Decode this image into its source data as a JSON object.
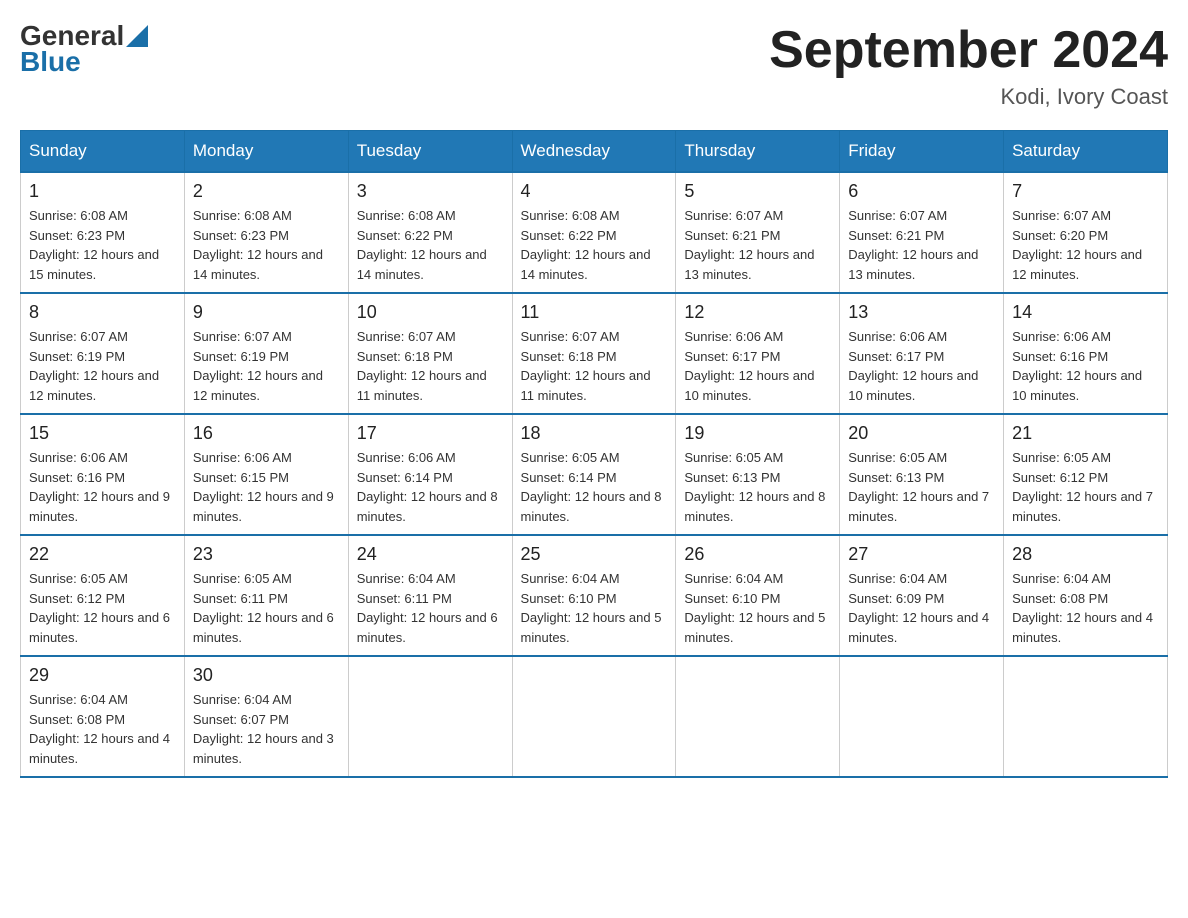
{
  "logo": {
    "general": "General",
    "blue": "Blue",
    "arrow": "▲"
  },
  "title": "September 2024",
  "subtitle": "Kodi, Ivory Coast",
  "days": [
    "Sunday",
    "Monday",
    "Tuesday",
    "Wednesday",
    "Thursday",
    "Friday",
    "Saturday"
  ],
  "weeks": [
    [
      {
        "num": "1",
        "sunrise": "6:08 AM",
        "sunset": "6:23 PM",
        "daylight": "12 hours and 15 minutes."
      },
      {
        "num": "2",
        "sunrise": "6:08 AM",
        "sunset": "6:23 PM",
        "daylight": "12 hours and 14 minutes."
      },
      {
        "num": "3",
        "sunrise": "6:08 AM",
        "sunset": "6:22 PM",
        "daylight": "12 hours and 14 minutes."
      },
      {
        "num": "4",
        "sunrise": "6:08 AM",
        "sunset": "6:22 PM",
        "daylight": "12 hours and 14 minutes."
      },
      {
        "num": "5",
        "sunrise": "6:07 AM",
        "sunset": "6:21 PM",
        "daylight": "12 hours and 13 minutes."
      },
      {
        "num": "6",
        "sunrise": "6:07 AM",
        "sunset": "6:21 PM",
        "daylight": "12 hours and 13 minutes."
      },
      {
        "num": "7",
        "sunrise": "6:07 AM",
        "sunset": "6:20 PM",
        "daylight": "12 hours and 12 minutes."
      }
    ],
    [
      {
        "num": "8",
        "sunrise": "6:07 AM",
        "sunset": "6:19 PM",
        "daylight": "12 hours and 12 minutes."
      },
      {
        "num": "9",
        "sunrise": "6:07 AM",
        "sunset": "6:19 PM",
        "daylight": "12 hours and 12 minutes."
      },
      {
        "num": "10",
        "sunrise": "6:07 AM",
        "sunset": "6:18 PM",
        "daylight": "12 hours and 11 minutes."
      },
      {
        "num": "11",
        "sunrise": "6:07 AM",
        "sunset": "6:18 PM",
        "daylight": "12 hours and 11 minutes."
      },
      {
        "num": "12",
        "sunrise": "6:06 AM",
        "sunset": "6:17 PM",
        "daylight": "12 hours and 10 minutes."
      },
      {
        "num": "13",
        "sunrise": "6:06 AM",
        "sunset": "6:17 PM",
        "daylight": "12 hours and 10 minutes."
      },
      {
        "num": "14",
        "sunrise": "6:06 AM",
        "sunset": "6:16 PM",
        "daylight": "12 hours and 10 minutes."
      }
    ],
    [
      {
        "num": "15",
        "sunrise": "6:06 AM",
        "sunset": "6:16 PM",
        "daylight": "12 hours and 9 minutes."
      },
      {
        "num": "16",
        "sunrise": "6:06 AM",
        "sunset": "6:15 PM",
        "daylight": "12 hours and 9 minutes."
      },
      {
        "num": "17",
        "sunrise": "6:06 AM",
        "sunset": "6:14 PM",
        "daylight": "12 hours and 8 minutes."
      },
      {
        "num": "18",
        "sunrise": "6:05 AM",
        "sunset": "6:14 PM",
        "daylight": "12 hours and 8 minutes."
      },
      {
        "num": "19",
        "sunrise": "6:05 AM",
        "sunset": "6:13 PM",
        "daylight": "12 hours and 8 minutes."
      },
      {
        "num": "20",
        "sunrise": "6:05 AM",
        "sunset": "6:13 PM",
        "daylight": "12 hours and 7 minutes."
      },
      {
        "num": "21",
        "sunrise": "6:05 AM",
        "sunset": "6:12 PM",
        "daylight": "12 hours and 7 minutes."
      }
    ],
    [
      {
        "num": "22",
        "sunrise": "6:05 AM",
        "sunset": "6:12 PM",
        "daylight": "12 hours and 6 minutes."
      },
      {
        "num": "23",
        "sunrise": "6:05 AM",
        "sunset": "6:11 PM",
        "daylight": "12 hours and 6 minutes."
      },
      {
        "num": "24",
        "sunrise": "6:04 AM",
        "sunset": "6:11 PM",
        "daylight": "12 hours and 6 minutes."
      },
      {
        "num": "25",
        "sunrise": "6:04 AM",
        "sunset": "6:10 PM",
        "daylight": "12 hours and 5 minutes."
      },
      {
        "num": "26",
        "sunrise": "6:04 AM",
        "sunset": "6:10 PM",
        "daylight": "12 hours and 5 minutes."
      },
      {
        "num": "27",
        "sunrise": "6:04 AM",
        "sunset": "6:09 PM",
        "daylight": "12 hours and 4 minutes."
      },
      {
        "num": "28",
        "sunrise": "6:04 AM",
        "sunset": "6:08 PM",
        "daylight": "12 hours and 4 minutes."
      }
    ],
    [
      {
        "num": "29",
        "sunrise": "6:04 AM",
        "sunset": "6:08 PM",
        "daylight": "12 hours and 4 minutes."
      },
      {
        "num": "30",
        "sunrise": "6:04 AM",
        "sunset": "6:07 PM",
        "daylight": "12 hours and 3 minutes."
      },
      null,
      null,
      null,
      null,
      null
    ]
  ]
}
